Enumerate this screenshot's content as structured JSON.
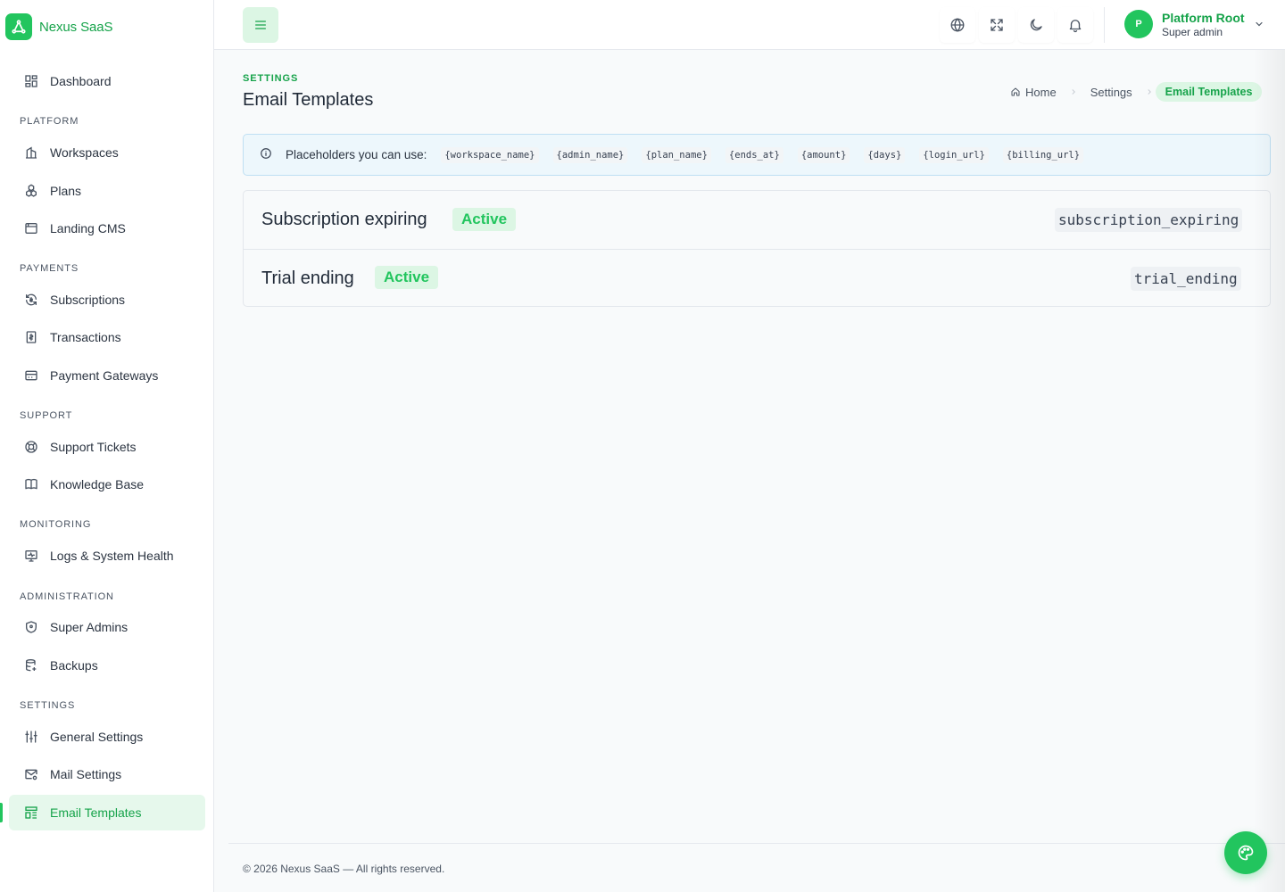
{
  "brand": {
    "name": "Nexus SaaS"
  },
  "sidebar": {
    "dashboard": "Dashboard",
    "sections": {
      "platform": "PLATFORM",
      "payments": "PAYMENTS",
      "support": "SUPPORT",
      "monitoring": "MONITORING",
      "administration": "ADMINISTRATION",
      "settings": "SETTINGS"
    },
    "items": {
      "workspaces": "Workspaces",
      "plans": "Plans",
      "landing_cms": "Landing CMS",
      "subscriptions": "Subscriptions",
      "transactions": "Transactions",
      "payment_gateways": "Payment Gateways",
      "support_tickets": "Support Tickets",
      "knowledge_base": "Knowledge Base",
      "logs": "Logs & System Health",
      "super_admins": "Super Admins",
      "backups": "Backups",
      "general_settings": "General Settings",
      "mail_settings": "Mail Settings",
      "email_templates": "Email Templates"
    },
    "active_item": "email_templates"
  },
  "topbar": {
    "icons": [
      "menu-icon",
      "globe-icon",
      "fullscreen-icon",
      "moon-icon",
      "bell-icon"
    ],
    "user": {
      "initial": "P",
      "name": "Platform Root",
      "role": "Super admin"
    }
  },
  "page": {
    "kicker": "SETTINGS",
    "title": "Email Templates",
    "breadcrumb": {
      "home": "Home",
      "settings": "Settings",
      "current": "Email Templates"
    }
  },
  "info": {
    "label": "Placeholders you can use:",
    "placeholders": [
      "{workspace_name}",
      "{admin_name}",
      "{plan_name}",
      "{ends_at}",
      "{amount}",
      "{days}",
      "{login_url}",
      "{billing_url}"
    ]
  },
  "templates": [
    {
      "name": "Subscription expiring",
      "status": "Active",
      "key": "subscription_expiring"
    },
    {
      "name": "Trial ending",
      "status": "Active",
      "key": "trial_ending"
    }
  ],
  "footer": {
    "text": "© 2026 Nexus SaaS — All rights reserved."
  },
  "colors": {
    "accent": "#22c55e",
    "accent_dark": "#16a34a",
    "accent_soft": "#dcf6e4",
    "info_bg": "#edf7fc",
    "info_border": "#bfdff3"
  }
}
